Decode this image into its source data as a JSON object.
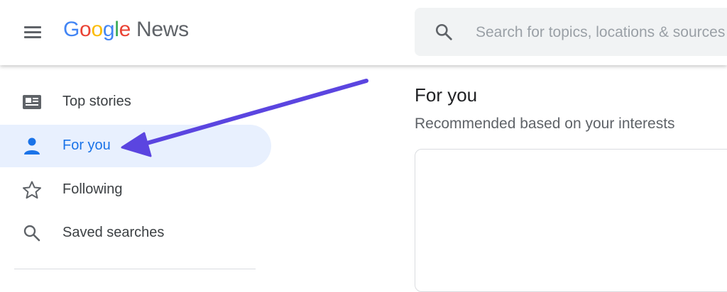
{
  "header": {
    "logo": {
      "letters": [
        "G",
        "o",
        "o",
        "g",
        "l",
        "e"
      ],
      "product": "News"
    },
    "menu_icon": "hamburger-menu-icon",
    "search": {
      "icon": "search-icon",
      "placeholder": "Search for topics, locations & sources"
    }
  },
  "sidebar": {
    "items": [
      {
        "label": "Top stories",
        "icon": "newspaper-icon",
        "active": false
      },
      {
        "label": "For you",
        "icon": "person-icon",
        "active": true
      },
      {
        "label": "Following",
        "icon": "star-outline-icon",
        "active": false
      },
      {
        "label": "Saved searches",
        "icon": "search-icon",
        "active": false
      }
    ]
  },
  "main": {
    "title": "For you",
    "subtitle": "Recommended based on your interests"
  },
  "annotation": {
    "icon": "arrow-annotation",
    "points_to": "For you"
  },
  "colors": {
    "accent": "#1a73e8",
    "active_bg": "#e8f0fe",
    "arrow": "#5b45e0",
    "search_bg": "#f1f3f4",
    "google_blue": "#4285f4",
    "google_red": "#ea4335",
    "google_yellow": "#fbbc05",
    "google_green": "#34a853"
  }
}
